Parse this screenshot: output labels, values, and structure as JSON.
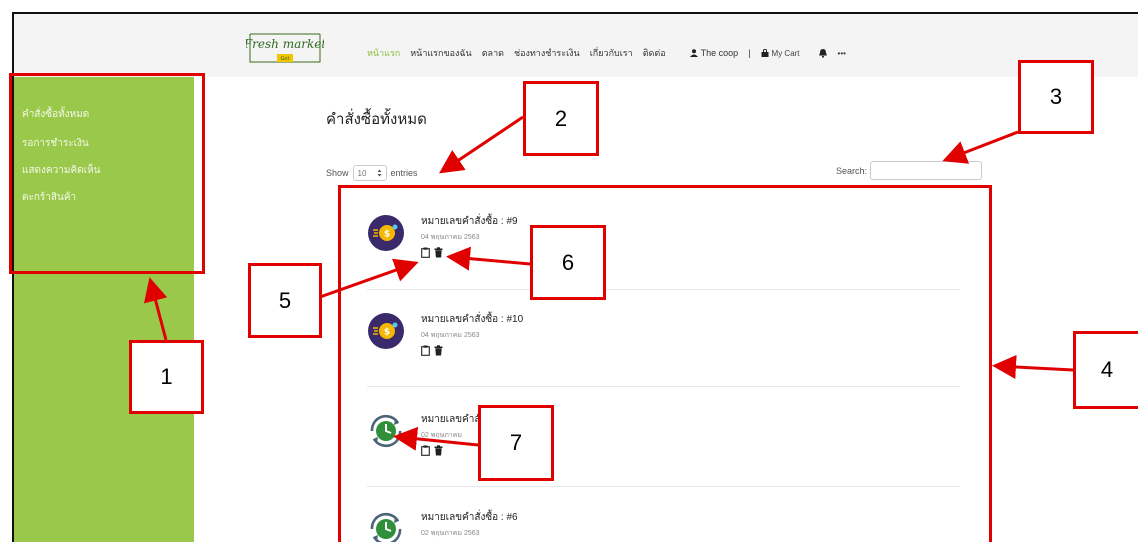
{
  "header": {
    "logo_text_top": "Fresh market",
    "logo_text_bottom": "Got",
    "nav_items": [
      "หน้าแรก",
      "หน้าแรกของฉัน",
      "ตลาด",
      "ช่องทางชำระเงิน",
      "เกี่ยวกับเรา",
      "ติดต่อ"
    ],
    "user_label": "The coop",
    "separator": "|",
    "cart_label": "My Cart",
    "more_label": "•••"
  },
  "sidebar": {
    "items": [
      "คำสั่งซื้อทั้งหมด",
      "รอการชำระเงิน",
      "แสดงความคิดเห็น",
      "ตะกร้าสินค้า"
    ]
  },
  "main": {
    "title": "คำสั่งซื้อทั้งหมด",
    "show_label": "Show",
    "entries_value": "10",
    "entries_label": "entries",
    "search_label": "Search:",
    "search_value": ""
  },
  "orders": [
    {
      "number": "หมายเลขคำสั่งซื้อ : #9",
      "date": "04 พฤษภาคม 2563",
      "status_icon": "coin-icon"
    },
    {
      "number": "หมายเลขคำสั่งซื้อ : #10",
      "date": "04 พฤษภาคม 2563",
      "status_icon": "coin-icon"
    },
    {
      "number": "หมายเลขคำสั่งซื้อ",
      "date": "02 พฤษภาคม",
      "status_icon": "clock-refresh-icon"
    },
    {
      "number": "หมายเลขคำสั่งซื้อ : #6",
      "date": "02 พฤษภาคม 2563",
      "status_icon": "clock-refresh-icon"
    }
  ],
  "callouts": [
    "1",
    "2",
    "3",
    "4",
    "5",
    "6",
    "7"
  ],
  "colors": {
    "sidebar": "#9ac84a",
    "nav_active": "#8bbf3a",
    "annotation": "#e00000"
  }
}
